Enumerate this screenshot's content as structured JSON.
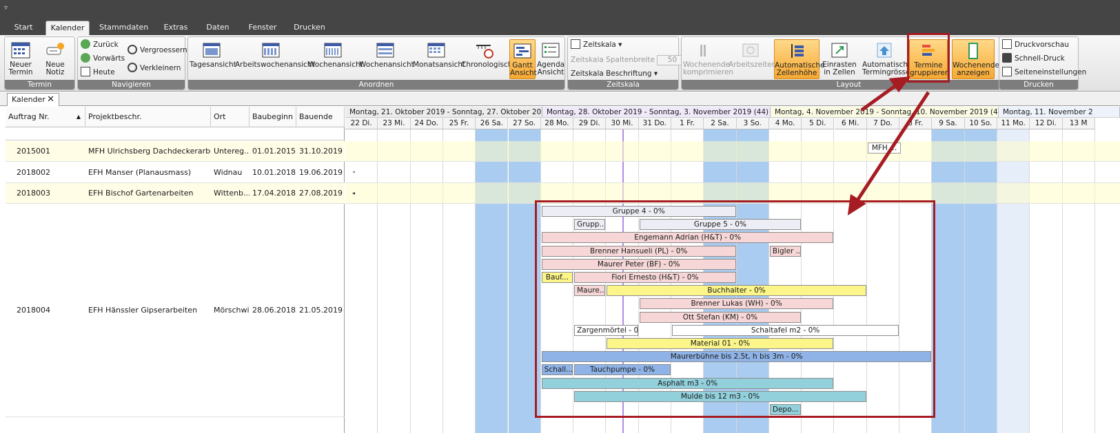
{
  "ribbon_tabs": [
    "Start",
    "Kalender",
    "Stammdaten",
    "Extras",
    "Daten",
    "Fenster",
    "Drucken"
  ],
  "active_tab": "Kalender",
  "groups": {
    "termin": {
      "label": "Termin",
      "new_appt": "Neuer Termin",
      "new_note": "Neue Notiz"
    },
    "navigieren": {
      "label": "Navigieren",
      "back": "Zurück",
      "forward": "Vorwärts",
      "today": "Heute",
      "zoom_in": "Vergroessern",
      "zoom_out": "Verkleinern"
    },
    "anordnen": {
      "label": "Anordnen",
      "views": [
        "Tagesansicht",
        "Arbeitswochenansicht",
        "Wochenansicht",
        "Wochenansicht",
        "Monatsansicht",
        "Chronologisch"
      ],
      "gantt": "Gantt Ansicht",
      "agenda": "Agenda Ansicht"
    },
    "zeitskala": {
      "label": "Zeitskala",
      "scale": "Zeitskala",
      "col_width": "Zeitskala Spaltenbreite",
      "col_width_value": "50",
      "caption": "Zeitskala Beschriftung"
    },
    "layout": {
      "label": "Layout",
      "compress_weekend": "Wochenende komprimieren",
      "work_times": "Arbeitszeiten",
      "auto_height": "Automatische Zellenhöhe",
      "snap": "Einrasten in Zellen",
      "auto_size": "Automatische Termingrösse",
      "group": "Termine gruppieren",
      "show_weekend": "Wochenende anzeigen"
    },
    "drucken": {
      "label": "Drucken",
      "preview": "Druckvorschau",
      "quick": "Schnell-Druck",
      "page_setup": "Seiteneinstellungen"
    }
  },
  "doc_tab": "Kalender",
  "grid": {
    "headers": [
      "Auftrag Nr.",
      "Projektbeschr.",
      "Ort",
      "Baubeginn",
      "Bauende"
    ],
    "rows": [
      {
        "nr": "2015001",
        "desc": "MFH Ulrichsberg Dachdeckerarbeiten",
        "ort": "Untereg...",
        "start": "01.01.2015",
        "end": "31.10.2019"
      },
      {
        "nr": "2018002",
        "desc": "EFH Manser (Planausmass)",
        "ort": "Widnau",
        "start": "10.01.2018",
        "end": "19.06.2019"
      },
      {
        "nr": "2018003",
        "desc": "EFH Bischof Gartenarbeiten",
        "ort": "Wittenb...",
        "start": "17.04.2018",
        "end": "27.08.2019"
      },
      {
        "nr": "2018004",
        "desc": "EFH Hänssler Gipserarbeiten",
        "ort": "Mörschwil",
        "start": "28.06.2018",
        "end": "21.05.2019"
      }
    ]
  },
  "weeks": [
    "Montag, 21. Oktober 2019 - Sonntag, 27. Oktober 2019 (...",
    "Montag, 28. Oktober 2019 - Sonntag, 3. November 2019 (44)",
    "Montag, 4. November 2019 - Sonntag, 10. November 2019 (45)",
    "Montag, 11. November 2"
  ],
  "days": [
    "22 Di.",
    "23 Mi.",
    "24 Do.",
    "25 Fr.",
    "26 Sa.",
    "27 So.",
    "28 Mo.",
    "29 Di.",
    "30 Mi.",
    "31 Do.",
    "1 Fr.",
    "2 Sa.",
    "3 So.",
    "4 Mo.",
    "5 Di.",
    "6 Mi.",
    "7 Do.",
    "8 Fr.",
    "9 Sa.",
    "10 So.",
    "11 Mo.",
    "12 Di.",
    "13 M"
  ],
  "row1_appt": "MFH ...",
  "bars": [
    {
      "label": "Gruppe 4 - 0%",
      "start": 6,
      "span": 6,
      "lane": 0,
      "color": "#ededf5"
    },
    {
      "label": "Grupp...",
      "start": 7,
      "span": 1,
      "lane": 1,
      "color": "#ededf5"
    },
    {
      "label": "Gruppe 5 - 0%",
      "start": 9,
      "span": 5,
      "lane": 1,
      "color": "#ededf5"
    },
    {
      "label": "Engemann Adrian (H&T) - 0%",
      "start": 6,
      "span": 9,
      "lane": 2,
      "color": "#f6d6d6"
    },
    {
      "label": "Brenner Hansueli (PL) - 0%",
      "start": 6,
      "span": 6,
      "lane": 3,
      "color": "#f6d6d6"
    },
    {
      "label": "Bigler ...",
      "start": 13,
      "span": 1,
      "lane": 3,
      "color": "#f6d6d6"
    },
    {
      "label": "Maurer Peter (BF) - 0%",
      "start": 6,
      "span": 6,
      "lane": 4,
      "color": "#f6d6d6"
    },
    {
      "label": "Bauf...",
      "start": 6,
      "span": 1,
      "lane": 5,
      "color": "#fbf58a"
    },
    {
      "label": "Fiori Ernesto (H&T) - 0%",
      "start": 7,
      "span": 5,
      "lane": 5,
      "color": "#f6d6d6"
    },
    {
      "label": "Maure...",
      "start": 7,
      "span": 1,
      "lane": 6,
      "color": "#f6d6d6"
    },
    {
      "label": "Buchhalter - 0%",
      "start": 8,
      "span": 8,
      "lane": 6,
      "color": "#fbf58a"
    },
    {
      "label": "Brenner Lukas (WH) - 0%",
      "start": 9,
      "span": 6,
      "lane": 7,
      "color": "#f6d6d6"
    },
    {
      "label": "Ott Stefan (KM) - 0%",
      "start": 9,
      "span": 5,
      "lane": 8,
      "color": "#f6d6d6"
    },
    {
      "label": "Zargenmörtel - 0...",
      "start": 7,
      "span": 2,
      "lane": 9,
      "color": "#ffffff"
    },
    {
      "label": "Schaltafel m2 - 0%",
      "start": 10,
      "span": 7,
      "lane": 9,
      "color": "#ffffff"
    },
    {
      "label": "Material 01 - 0%",
      "start": 8,
      "span": 7,
      "lane": 10,
      "color": "#fbf58a"
    },
    {
      "label": "Maurerbühne bis 2.5t, h bis 3m - 0%",
      "start": 6,
      "span": 12,
      "lane": 11,
      "color": "#8fb3e6"
    },
    {
      "label": "Schall...",
      "start": 6,
      "span": 1,
      "lane": 12,
      "color": "#8fb3e6"
    },
    {
      "label": "Tauchpumpe - 0%",
      "start": 7,
      "span": 3,
      "lane": 12,
      "color": "#8fb3e6"
    },
    {
      "label": "Asphalt m3 - 0%",
      "start": 6,
      "span": 9,
      "lane": 13,
      "color": "#92d0dc"
    },
    {
      "label": "Mulde bis 12 m3 - 0%",
      "start": 7,
      "span": 9,
      "lane": 14,
      "color": "#92d0dc"
    },
    {
      "label": "Depo...",
      "start": 13,
      "span": 1,
      "lane": 15,
      "color": "#92d0dc"
    }
  ],
  "colors": {
    "weekend": "#a9ccf0",
    "row_highlight": "#fffde6",
    "annotation": "#a61c23",
    "today_line": "#b48ae8"
  }
}
